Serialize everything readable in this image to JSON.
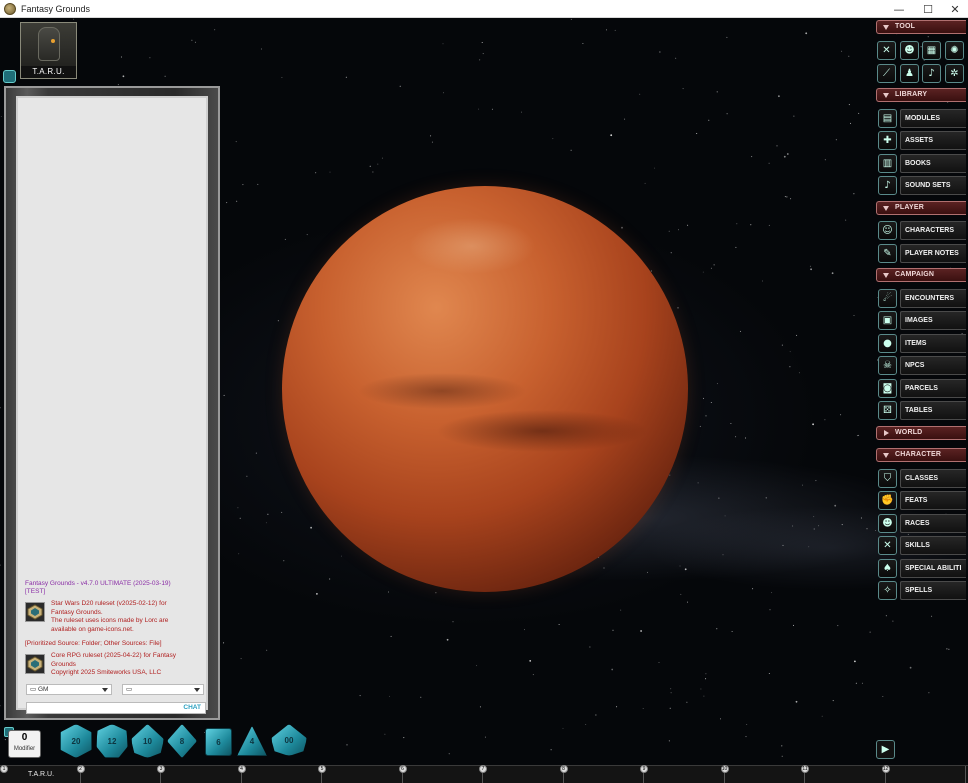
{
  "window": {
    "title": "Fantasy Grounds",
    "minimize": "—",
    "maximize": "☐",
    "close": "✕"
  },
  "portrait": {
    "name": "T.A.R.U."
  },
  "chat": {
    "version_line1": "Fantasy Grounds - v4.7.0 ULTIMATE (2025-03-19)",
    "version_line2": "[TEST]",
    "msg1": [
      "Star Wars D20 ruleset (v2025-02-12) for",
      "Fantasy Grounds.",
      "The ruleset uses icons made by Lorc are",
      "available on game-icons.net."
    ],
    "sources": "[Prioritized Source: Folder; Other Sources: File]",
    "msg2": [
      "Core RPG ruleset (2025-04-22) for Fantasy",
      "Grounds",
      "Copyright 2025 Smiteworks USA, LLC"
    ],
    "identity": "GM",
    "channel": "",
    "input_label": "CHAT"
  },
  "sidebar": {
    "tool_label": "TOOL",
    "library_label": "LIBRARY",
    "library_items": [
      "MODULES",
      "ASSETS",
      "BOOKS",
      "SOUND SETS"
    ],
    "player_label": "PLAYER",
    "player_items": [
      "CHARACTERS",
      "PLAYER NOTES"
    ],
    "campaign_label": "CAMPAIGN",
    "campaign_items": [
      "ENCOUNTERS",
      "IMAGES",
      "ITEMS",
      "NPCS",
      "PARCELS",
      "TABLES"
    ],
    "world_label": "WORLD",
    "character_label": "CHARACTER",
    "character_items": [
      "CLASSES",
      "FEATS",
      "RACES",
      "SKILLS",
      "SPECIAL ABILITI",
      "SPELLS"
    ]
  },
  "dice": {
    "modifier_value": "0",
    "modifier_label": "Modifier",
    "faces": [
      "20",
      "12",
      "10",
      "8",
      "6",
      "4",
      "00"
    ]
  },
  "hotkeys": {
    "slot1_label": "T.A.R.U.",
    "numbers": [
      "1",
      "2",
      "3",
      "4",
      "5",
      "6",
      "7",
      "8",
      "9",
      "10",
      "11",
      "12"
    ]
  }
}
